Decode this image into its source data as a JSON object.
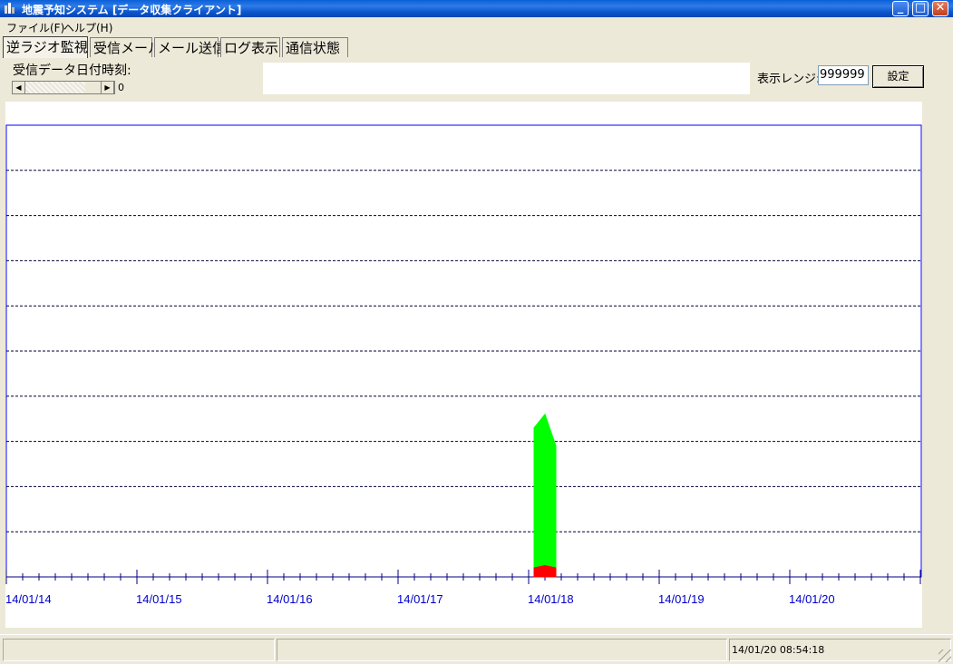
{
  "window": {
    "title": "地震予知システム [データ収集クライアント]",
    "buttons": {
      "minimize": "_",
      "maximize": "□",
      "close": "✕"
    }
  },
  "menu": [
    "ファイル(F)",
    "ヘルプ(H)"
  ],
  "tabs": [
    "逆ラジオ監視",
    "受信メール",
    "メール送信",
    "ログ表示",
    "通信状態"
  ],
  "controls": {
    "date_label": "受信データ日付時刻:",
    "slider_value": "0",
    "range_label": "表示レンジ:",
    "range_value": "999999",
    "set_button": "設定"
  },
  "chart_data": {
    "type": "area",
    "x_tick_labels": [
      "14/01/14",
      "14/01/15",
      "14/01/16",
      "14/01/17",
      "14/01/18",
      "14/01/19",
      "14/01/20"
    ],
    "grid": "horizontal dashed",
    "series": [
      {
        "color": "#00FF00",
        "x": [
          "14/01/18 01:00",
          "14/01/18 03:00",
          "14/01/18 05:00"
        ],
        "values": [
          0.33,
          0.36,
          0.29
        ]
      },
      {
        "color": "#FF0000",
        "x": [
          "14/01/18 01:00",
          "14/01/18 03:00",
          "14/01/18 05:00"
        ],
        "values": [
          0.02,
          0.025,
          0.02
        ]
      }
    ],
    "line_color": "#0000FF",
    "label_color": "#0000CC"
  },
  "statusbar": {
    "panels": [
      "",
      "",
      "14/01/20 08:54:18"
    ]
  }
}
